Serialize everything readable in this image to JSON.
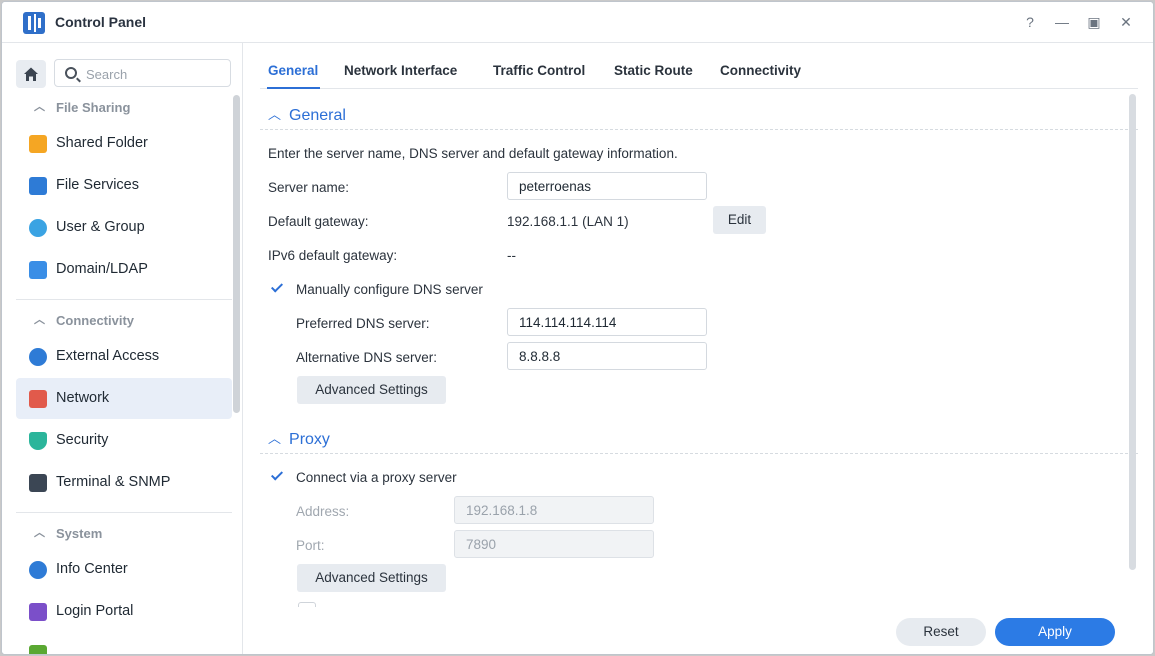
{
  "window": {
    "title": "Control Panel",
    "help_glyph": "?",
    "minimize_glyph": "—",
    "maximize_glyph": "▣",
    "close_glyph": "✕"
  },
  "sidebar": {
    "search_placeholder": "Search",
    "sections": [
      {
        "title": "File Sharing",
        "items": [
          {
            "label": "Shared Folder",
            "icon": "shared-folder-icon",
            "color": "#f5a623"
          },
          {
            "label": "File Services",
            "icon": "file-services-icon",
            "color": "#2e7bd6"
          },
          {
            "label": "User & Group",
            "icon": "user-group-icon",
            "color": "#3aa3e3"
          },
          {
            "label": "Domain/LDAP",
            "icon": "domain-ldap-icon",
            "color": "#3a8ee6"
          }
        ]
      },
      {
        "title": "Connectivity",
        "items": [
          {
            "label": "External Access",
            "icon": "external-access-icon",
            "color": "#2e7bd6"
          },
          {
            "label": "Network",
            "icon": "network-icon",
            "color": "#e15a4b",
            "active": true
          },
          {
            "label": "Security",
            "icon": "security-icon",
            "color": "#2bb59b"
          },
          {
            "label": "Terminal & SNMP",
            "icon": "terminal-icon",
            "color": "#3b4654"
          }
        ]
      },
      {
        "title": "System",
        "items": [
          {
            "label": "Info Center",
            "icon": "info-center-icon",
            "color": "#2e7bd6"
          },
          {
            "label": "Login Portal",
            "icon": "login-portal-icon",
            "color": "#7b4fc9"
          }
        ]
      }
    ]
  },
  "tabs": [
    "General",
    "Network Interface",
    "Traffic Control",
    "Static Route",
    "Connectivity"
  ],
  "general": {
    "title": "General",
    "description": "Enter the server name, DNS server and default gateway information.",
    "server_name_label": "Server name:",
    "server_name_value": "peterroenas",
    "default_gateway_label": "Default gateway:",
    "default_gateway_value": "192.168.1.1 (LAN 1)",
    "edit_button": "Edit",
    "ipv6_gateway_label": "IPv6 default gateway:",
    "ipv6_gateway_value": "--",
    "manual_dns_label": "Manually configure DNS server",
    "manual_dns_checked": true,
    "preferred_dns_label": "Preferred DNS server:",
    "preferred_dns_value": "114.114.114.114",
    "alternative_dns_label": "Alternative DNS server:",
    "alternative_dns_value": "8.8.8.8",
    "advanced_button": "Advanced Settings"
  },
  "proxy": {
    "title": "Proxy",
    "connect_label": "Connect via a proxy server",
    "connect_checked": true,
    "address_label": "Address:",
    "address_value": "192.168.1.8",
    "port_label": "Port:",
    "port_value": "7890",
    "advanced_button": "Advanced Settings"
  },
  "footer": {
    "reset": "Reset",
    "apply": "Apply"
  },
  "colors": {
    "accent": "#2c6fd6",
    "apply_button": "#2c7be5",
    "active_nav_bg": "#e8eef8"
  }
}
